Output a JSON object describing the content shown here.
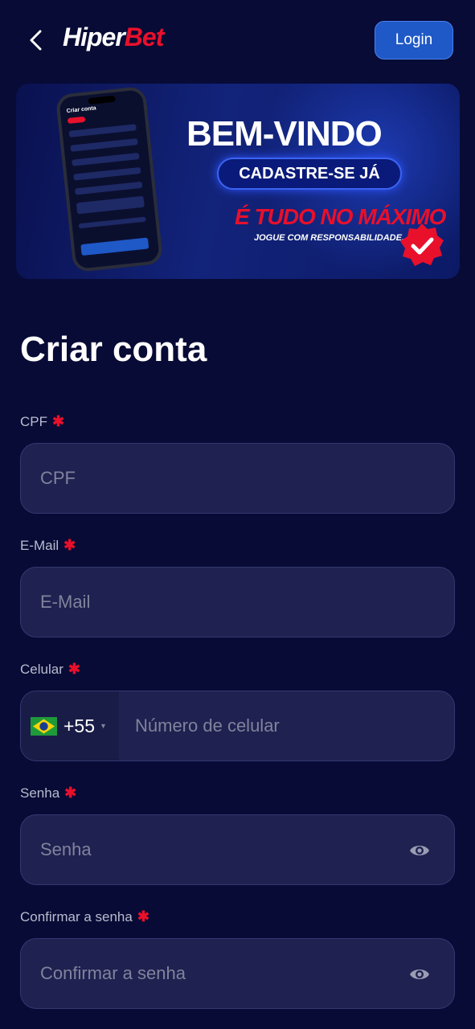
{
  "header": {
    "logo_part1": "Hiper",
    "logo_part2": "Bet",
    "login_label": "Login"
  },
  "banner": {
    "title": "BEM-VINDO",
    "pill": "CADASTRE-SE JÁ",
    "tagline": "É TUDO NO MÁXIMO",
    "subtagline": "JOGUE COM RESPONSABILIDADE.",
    "phone_screen_title": "Criar conta"
  },
  "page": {
    "title": "Criar conta"
  },
  "form": {
    "cpf": {
      "label": "CPF",
      "placeholder": "CPF"
    },
    "email": {
      "label": "E-Mail",
      "placeholder": "E-Mail"
    },
    "celular": {
      "label": "Celular",
      "country_code": "+55",
      "placeholder": "Número de celular"
    },
    "senha": {
      "label": "Senha",
      "placeholder": "Senha"
    },
    "confirmar": {
      "label": "Confirmar a senha",
      "placeholder": "Confirmar a senha"
    },
    "required_marker": "✱"
  },
  "icons": {
    "back": "chevron-left-icon",
    "eye": "eye-icon",
    "flag": "brazil-flag-icon",
    "badge": "check-badge-icon"
  },
  "colors": {
    "background": "#070b35",
    "accent_red": "#e8102b",
    "login_blue": "#1f58c7",
    "field_bg": "#1f2150"
  }
}
